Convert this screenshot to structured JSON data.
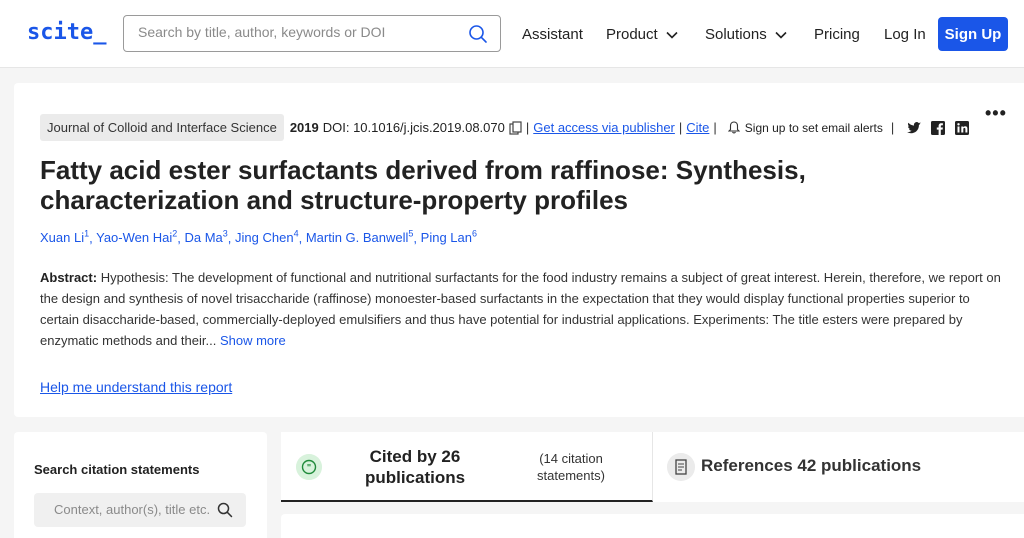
{
  "header": {
    "logo": "scite_",
    "search_placeholder": "Search by title, author, keywords or DOI",
    "nav": {
      "assistant": "Assistant",
      "product": "Product",
      "solutions": "Solutions",
      "pricing": "Pricing",
      "login": "Log In",
      "signup": "Sign Up"
    }
  },
  "paper": {
    "journal": "Journal of Colloid and Interface Science",
    "year": "2019",
    "doi": "DOI: 10.1016/j.jcis.2019.08.070",
    "access_link": "Get access via publisher",
    "cite_link": "Cite",
    "alerts": "Sign up to set email alerts",
    "more": "•••",
    "title": "Fatty acid ester surfactants derived from raffinose: Synthesis, characterization and structure-property profiles",
    "authors": [
      {
        "name": "Xuan Li",
        "sup": "1"
      },
      {
        "name": "Yao-Wen Hai",
        "sup": "2"
      },
      {
        "name": "Da Ma",
        "sup": "3"
      },
      {
        "name": "Jing Chen",
        "sup": "4"
      },
      {
        "name": "Martin G. Banwell",
        "sup": "5"
      },
      {
        "name": "Ping Lan",
        "sup": "6"
      }
    ],
    "abstract_label": "Abstract:",
    "abstract_text": "Hypothesis: The development of functional and nutritional surfactants for the food industry remains a subject of great interest. Herein, therefore, we report on the design and synthesis of novel trisaccharide (raffinose) monoester-based surfactants in the expectation that they would display functional properties superior to certain disaccharide-based, commercially-deployed emulsifiers and thus have potential for industrial applications. Experiments: The title esters were prepared by enzymatic methods and their...",
    "show_more": "Show more",
    "help_link": "Help me understand this report"
  },
  "sidebar": {
    "title": "Search citation statements",
    "input_placeholder": "Context, author(s), title etc."
  },
  "tabs": {
    "cited": {
      "label": "Cited by 26 publications",
      "sub": "(14 citation statements)"
    },
    "references": {
      "label": "References 42 publications"
    }
  },
  "colors": {
    "brand": "#1a56e8",
    "cite_badge": "#d8f2dc",
    "page_bg": "#f5f5f5"
  },
  "icons": [
    "search-icon",
    "chevron-down-icon",
    "copy-icon",
    "bell-icon",
    "twitter-icon",
    "facebook-icon",
    "linkedin-icon",
    "quote-icon",
    "document-icon"
  ]
}
